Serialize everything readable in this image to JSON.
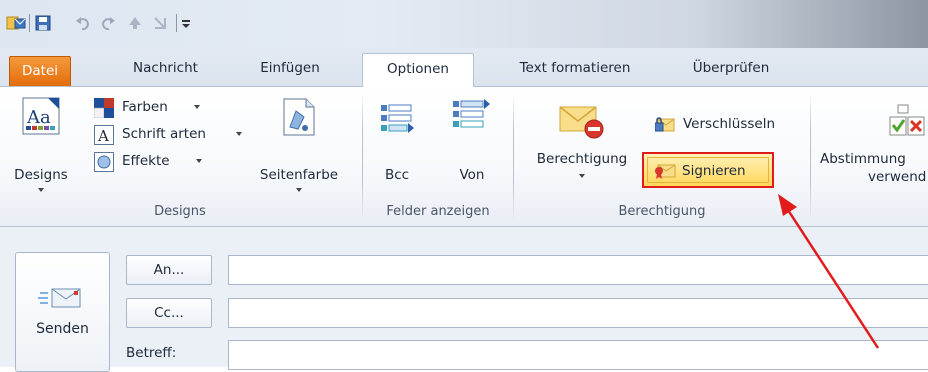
{
  "tabs": [
    {
      "label": "Datei"
    },
    {
      "label": "Nachricht"
    },
    {
      "label": "Einfügen"
    },
    {
      "label": "Optionen"
    },
    {
      "label": "Text formatieren"
    },
    {
      "label": "Überprüfen"
    }
  ],
  "ribbon": {
    "designs_group": {
      "label": "Designs",
      "designs_button": "Designs",
      "farben": "Farben",
      "schriftarten": "Schrift arten",
      "effekte": "Effekte",
      "seitenfarbe": "Seitenfarbe"
    },
    "felder_group": {
      "label": "Felder anzeigen",
      "bcc": "Bcc",
      "von": "Von"
    },
    "berechtigung_group": {
      "label": "Berechtigung",
      "berechtigung_button": "Berechtigung",
      "verschluesseln": "Verschlüsseln",
      "signieren": "Signieren"
    },
    "abstimmung": {
      "line1": "Abstimmung",
      "line2": "verwend"
    }
  },
  "compose": {
    "send": "Senden",
    "an": "An...",
    "cc": "Cc...",
    "betreff": "Betreff:"
  },
  "colors": {
    "file_tab": "#e46c0a",
    "highlight_border": "#e21b1b",
    "highlight_fill": "#ffd75a",
    "arrow": "#e21b1b"
  },
  "icons": [
    "outlook-app-icon",
    "save-icon",
    "undo-icon",
    "redo-icon",
    "up-arrow-icon",
    "down-arrow-icon",
    "customize-toolbar-icon",
    "designs-icon",
    "farben-icon",
    "schriftarten-icon",
    "effekte-icon",
    "seitenfarbe-icon",
    "bcc-icon",
    "von-icon",
    "berechtigung-icon",
    "verschluesseln-icon",
    "signieren-icon",
    "abstimmung-icon",
    "send-envelope-icon"
  ]
}
